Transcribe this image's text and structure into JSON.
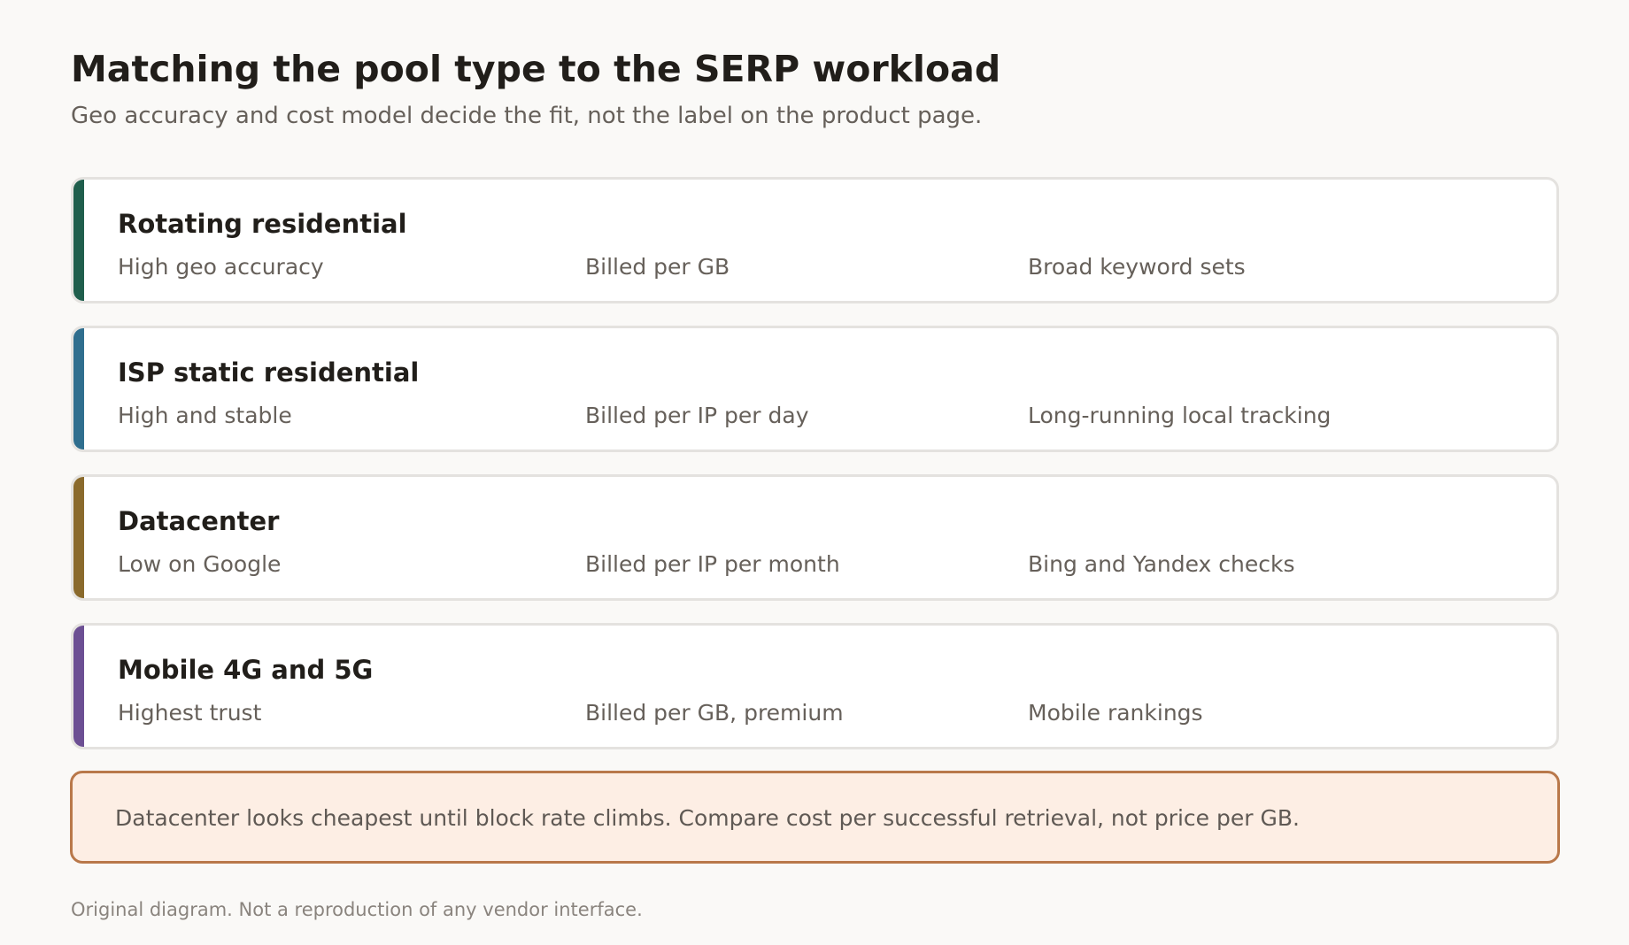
{
  "header": {
    "title": "Matching the pool type to the SERP workload",
    "subtitle": "Geo accuracy and cost model decide the fit, not the label on the product page."
  },
  "rows": [
    {
      "name": "Rotating residential",
      "geo_accuracy": "High geo accuracy",
      "billing": "Billed per GB",
      "best_for": "Broad keyword sets",
      "color": "#1f5e4c"
    },
    {
      "name": "ISP static residential",
      "geo_accuracy": "High and stable",
      "billing": "Billed per IP per day",
      "best_for": "Long-running local tracking",
      "color": "#2f6e8e"
    },
    {
      "name": "Datacenter",
      "geo_accuracy": "Low on Google",
      "billing": "Billed per IP per month",
      "best_for": "Bing and Yandex checks",
      "color": "#8a6a2c"
    },
    {
      "name": "Mobile 4G and 5G",
      "geo_accuracy": "Highest trust",
      "billing": "Billed per GB, premium",
      "best_for": "Mobile rankings",
      "color": "#6c4f93"
    }
  ],
  "callout": {
    "text": "Datacenter looks cheapest until block rate climbs. Compare cost per successful retrieval, not price per GB.",
    "border_color": "#b9784a",
    "background_color": "#fdeee4"
  },
  "footnote": "Original diagram. Not a reproduction of any vendor interface."
}
